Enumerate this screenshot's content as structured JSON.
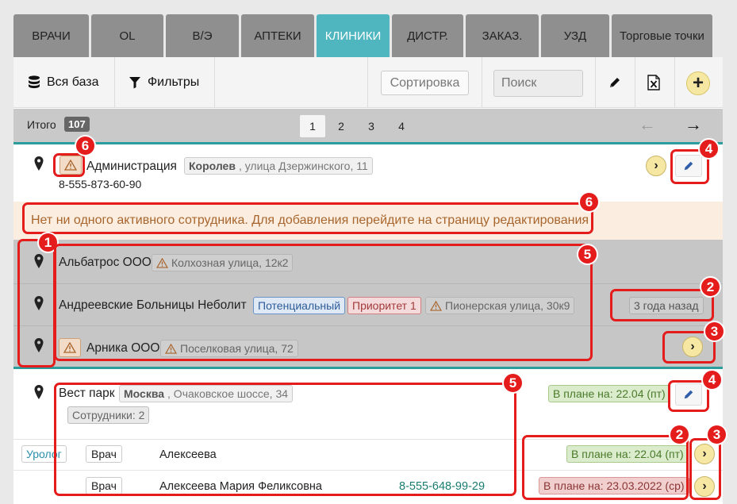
{
  "tabs": [
    {
      "label": "ВРАЧИ",
      "active": false
    },
    {
      "label": "OL",
      "active": false
    },
    {
      "label": "В/Э",
      "active": false
    },
    {
      "label": "АПТЕКИ",
      "active": false
    },
    {
      "label": "КЛИНИКИ",
      "active": true
    },
    {
      "label": "ДИСТР.",
      "active": false
    },
    {
      "label": "ЗАКАЗ.",
      "active": false
    },
    {
      "label": "УЗД",
      "active": false
    },
    {
      "label": "Торговые точки",
      "active": false
    }
  ],
  "toolbar": {
    "all_base_label": "Вся база",
    "filters_label": "Фильтры",
    "sort_label": "Сортировка",
    "search_placeholder": "Поиск",
    "icons": [
      "database-icon",
      "filter-icon",
      "pencil-icon",
      "excel-icon",
      "plus-icon"
    ]
  },
  "pager": {
    "total_label": "Итого",
    "total_count": "107",
    "pages": [
      "1",
      "2",
      "3",
      "4"
    ],
    "current_page": "1"
  },
  "clinics": {
    "administration": {
      "name": "Администрация",
      "city": "Королев",
      "street": ", улица Дзержинского, 11",
      "phone": "8-555-873-60-90",
      "warning": "Нет ни одного активного сотрудника. Для добавления перейдите на страницу редактирования"
    },
    "albatros": {
      "name": "Альбатрос ООО",
      "address": "Колхозная улица, 12к2"
    },
    "andreevskie": {
      "name": "Андреевские Больницы Неболит",
      "tag_status": "Потенциальный",
      "tag_priority": "Приоритет 1",
      "address": "Пионерская улица, 30к9",
      "last_visit": "3 года назад"
    },
    "arnika": {
      "name": "Арника ООО",
      "address": "Поселковая улица, 72"
    },
    "vest_park": {
      "name": "Вест парк",
      "city": "Москва",
      "street": ", Очаковское шоссе, 34",
      "employees": "Сотрудники: 2",
      "plan": "В плане на: 22.04 (пт)",
      "employees_list": [
        {
          "spec": "Уролог",
          "role": "Врач",
          "name": "Алексеева",
          "phone": "",
          "plan": "В плане на: 22.04 (пт)"
        },
        {
          "spec": "",
          "role": "Врач",
          "name": "Алексеева Мария Феликсовна",
          "phone": "8-555-648-99-29",
          "plan": "В плане на: 23.03.2022 (ср)"
        }
      ]
    }
  },
  "annotations": [
    "1",
    "2",
    "2",
    "3",
    "3",
    "4",
    "4",
    "5",
    "5",
    "6",
    "6"
  ],
  "colors": {
    "accent_teal": "#4fb6bf",
    "annotation_red": "#e41c1c",
    "plan_green": "#dbeccd",
    "plan_overdue": "#f2cfcf"
  }
}
